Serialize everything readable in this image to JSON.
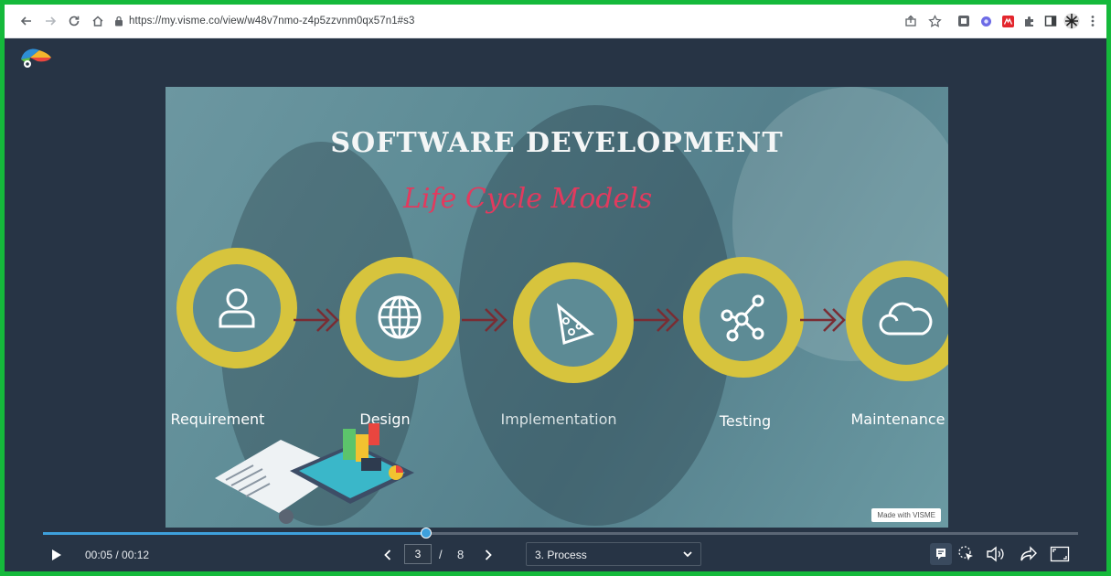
{
  "browser": {
    "url": "https://my.visme.co/view/w48v7nmo-z4p5zzvnm0qx57n1#s3"
  },
  "slide": {
    "title": "SOFTWARE DEVELOPMENT",
    "subtitle": "Life Cycle Models",
    "steps": [
      {
        "label": "Requirement",
        "icon": "person-icon"
      },
      {
        "label": "Design",
        "icon": "globe-icon"
      },
      {
        "label": "Implementation",
        "icon": "pizza-icon"
      },
      {
        "label": "Testing",
        "icon": "network-icon"
      },
      {
        "label": "Maintenance",
        "icon": "cloud-icon"
      }
    ],
    "watermark": "Made with VISME",
    "ring_color": "#d7c43d",
    "arrow_color": "#7a2c33",
    "subtitle_color": "#e23a5e"
  },
  "player": {
    "time": "00:05 / 00:12",
    "progress": 0.37,
    "page_current": "3",
    "page_separator": "/",
    "page_total": "8",
    "section": "3. Process"
  }
}
